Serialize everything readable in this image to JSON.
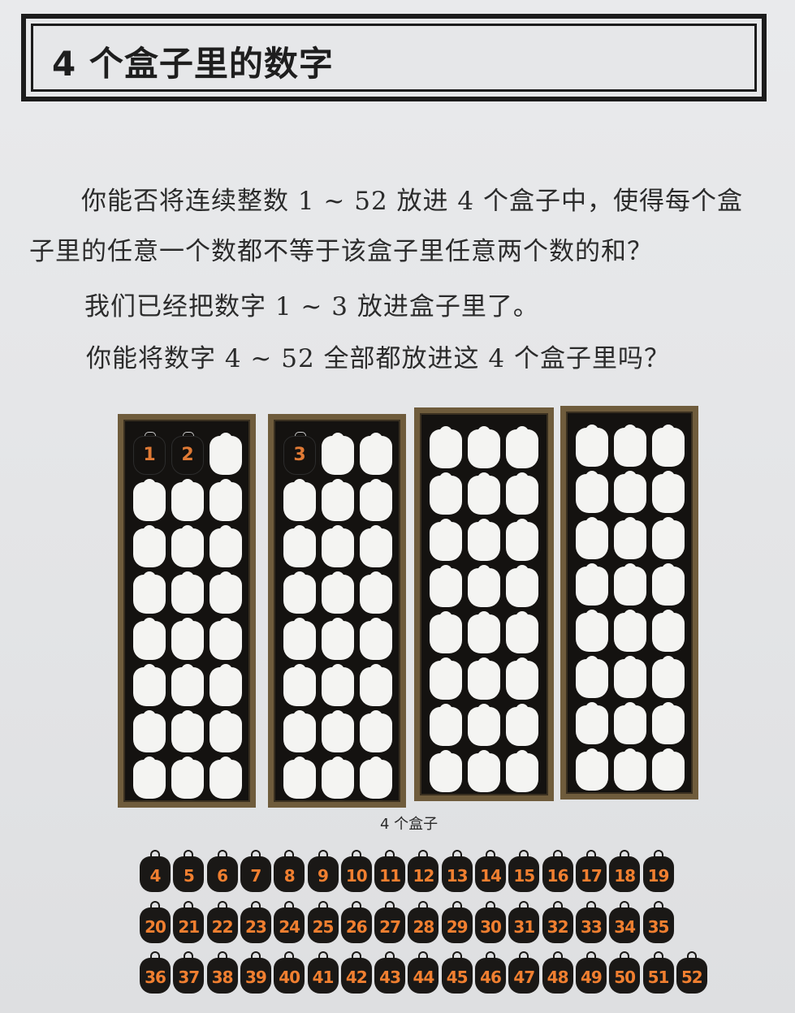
{
  "title": "4 个盒子里的数字",
  "paragraphs": [
    "你能否将连续整数 1 ~ 52 放进 4 个盒子中，使得每个盒",
    "子里的任意一个数都不等于该盒子里任意两个数的和？",
    "我们已经把数字 1 ~ 3 放进盒子里了。",
    "你能将数字 4 ~ 52 全部都放进这 4 个盒子里吗？"
  ],
  "boxes": [
    {
      "filled": [
        "1",
        "2"
      ]
    },
    {
      "filled": [
        "3"
      ]
    },
    {
      "filled": []
    },
    {
      "filled": []
    }
  ],
  "caption": "4 个盒子",
  "tile_rows": [
    [
      "4",
      "5",
      "6",
      "7",
      "8",
      "9",
      "10",
      "11",
      "12",
      "13",
      "14",
      "15",
      "16",
      "17",
      "18",
      "19"
    ],
    [
      "20",
      "21",
      "22",
      "23",
      "24",
      "25",
      "26",
      "27",
      "28",
      "29",
      "30",
      "31",
      "32",
      "33",
      "34",
      "35"
    ],
    [
      "36",
      "37",
      "38",
      "39",
      "40",
      "41",
      "42",
      "43",
      "44",
      "45",
      "46",
      "47",
      "48",
      "49",
      "50",
      "51",
      "52"
    ]
  ],
  "colors": {
    "number": "#e07a35",
    "box_frame": "#6f5c3c",
    "box_body": "#141210",
    "slot": "#f4f4f2"
  }
}
